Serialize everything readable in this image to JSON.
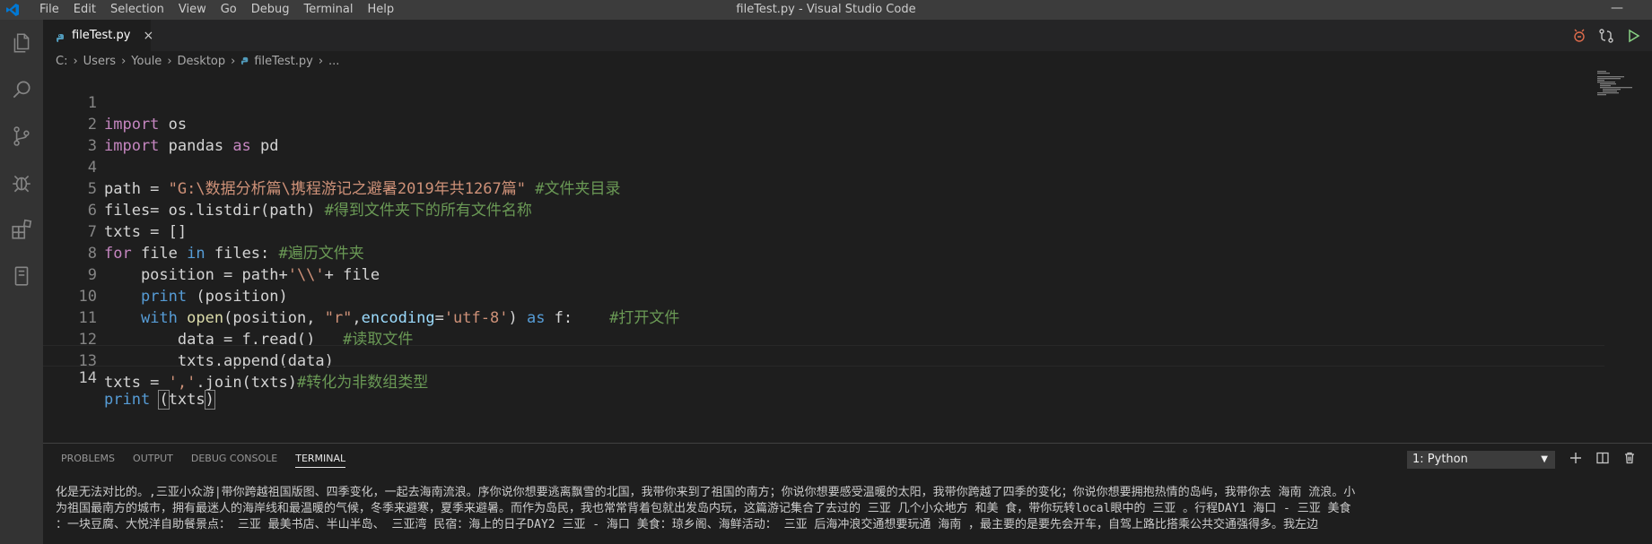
{
  "window": {
    "title": "fileTest.py - Visual Studio Code",
    "minimize_glyph": "—"
  },
  "menu": [
    "File",
    "Edit",
    "Selection",
    "View",
    "Go",
    "Debug",
    "Terminal",
    "Help"
  ],
  "activity_icons": [
    "files-icon",
    "search-icon",
    "source-control-icon",
    "debug-icon",
    "extensions-icon",
    "remote-explorer-icon"
  ],
  "tab": {
    "label": "fileTest.py",
    "close_glyph": "×"
  },
  "breadcrumb": [
    "C:",
    "Users",
    "Youle",
    "Desktop",
    "fileTest.py",
    "..."
  ],
  "editor": {
    "line_numbers": [
      "1",
      "2",
      "3",
      "4",
      "5",
      "6",
      "7",
      "8",
      "9",
      "10",
      "11",
      "12",
      "13",
      "14"
    ],
    "current_line": "14"
  },
  "panel": {
    "tabs": [
      "PROBLEMS",
      "OUTPUT",
      "DEBUG CONSOLE",
      "TERMINAL"
    ],
    "active_tab": "TERMINAL",
    "terminal_select": "1: Python",
    "terminal_lines": [
      "化是无法对比的。,三亚小众游|带你跨越祖国版图、四季变化，一起去海南流浪。序你说你想要逃离飘雪的北国，我带你来到了祖国的南方；你说你想要感受温暖的太阳，我带你跨越了四季的变化；你说你想要拥抱热情的岛屿，我带你去 海南 流浪。小",
      "为祖国最南方的城市，拥有最迷人的海岸线和最温暖的气候，冬季来避寒，夏季来避暑。而作为岛民，我也常常背着包就出发岛内玩，这篇游记集合了去过的 三亚 几个小众地方 和美 食，带你玩转local眼中的 三亚 。行程DAY1 海口 - 三亚 美食",
      "：一块豆腐、大悦洋自助餐景点： 三亚 最美书店、半山半岛、 三亚湾 民宿：海上的日子DAY2 三亚 - 海口 美食：琼乡阁、海鲜活动： 三亚 后海冲浪交通想要玩通 海南 ，最主要的是要先会开车，自驾上路比搭乘公共交通强得多。我左边"
    ]
  },
  "colors": {
    "title_bar": "#3c3c3c",
    "activity_bar": "#333333",
    "editor_bg": "#1e1e1e",
    "keyword": "#c586c0",
    "builtin": "#569cd6",
    "function": "#dcdcaa",
    "string": "#ce9178",
    "comment": "#6a9955",
    "vscode_blue": "#0078d4"
  }
}
